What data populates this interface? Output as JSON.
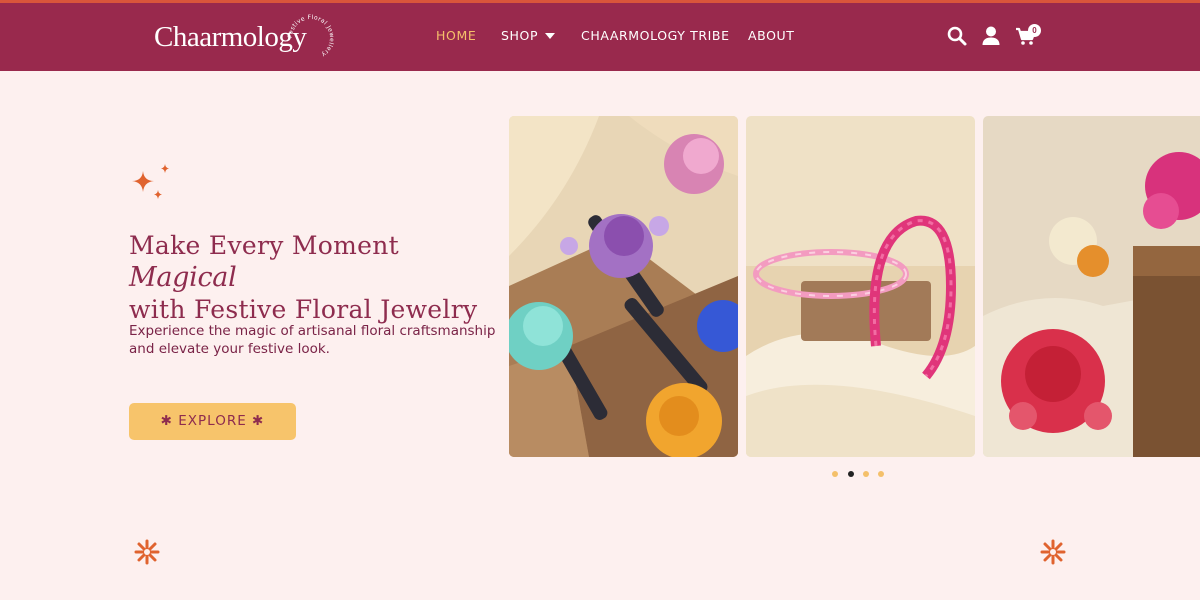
{
  "header": {
    "logo_text": "Chaarmology",
    "logo_tagline": "Festive Floral Jewellery",
    "nav": {
      "home": "HOME",
      "shop": "SHOP",
      "tribe": "CHAARMOLOGY TRIBE",
      "about": "ABOUT"
    },
    "cart_count": "0"
  },
  "hero": {
    "headline_part1": "Make Every Moment ",
    "headline_script": "Magical",
    "headline_part2": "with Festive Floral Jewelry",
    "subtext": "Experience the magic of artisanal floral craftsmanship and elevate your festive look.",
    "cta_label": "✱ EXPLORE ✱"
  },
  "carousel": {
    "slides": [
      "hair-clips-slide",
      "floral-tiara-slide",
      "floral-bracelet-slide"
    ],
    "active_dot": 1,
    "dot_count": 4
  },
  "colors": {
    "header_bg": "#99294d",
    "accent_top": "#d9553b",
    "page_bg": "#fdf0ef",
    "headline": "#8e2c4e",
    "cta_bg": "#f7c46b",
    "nav_active": "#f5c06a"
  }
}
